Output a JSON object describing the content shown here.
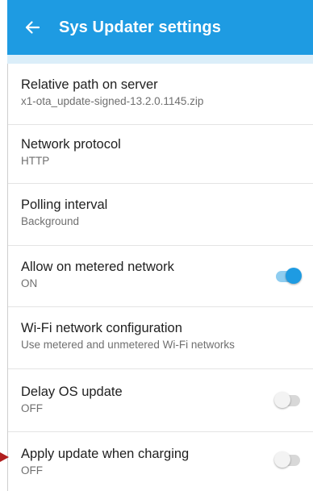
{
  "app_bar": {
    "title": "Sys Updater settings",
    "back_icon": "arrow-left-icon",
    "color": "#1e9be2"
  },
  "settings": [
    {
      "title": "Relative path on server",
      "summary": "x1-ota_update-signed-13.2.0.1145.zip"
    },
    {
      "title": "Network protocol",
      "summary": "HTTP"
    },
    {
      "title": "Polling interval",
      "summary": "Background"
    },
    {
      "title": "Allow on metered network",
      "summary": "ON",
      "toggle": true,
      "checked": true
    },
    {
      "title": "Wi-Fi network configuration",
      "summary": "Use metered and unmetered Wi-Fi networks"
    },
    {
      "title": "Delay OS update",
      "summary": "OFF",
      "toggle": true,
      "checked": false
    },
    {
      "title": "Apply update when charging",
      "summary": "OFF",
      "toggle": true,
      "checked": false
    }
  ],
  "colors": {
    "accent": "#1e9be2",
    "switch_on_track": "#8fcdf0",
    "switch_off_track": "#d8d8d8",
    "marker": "#b01e1e"
  }
}
